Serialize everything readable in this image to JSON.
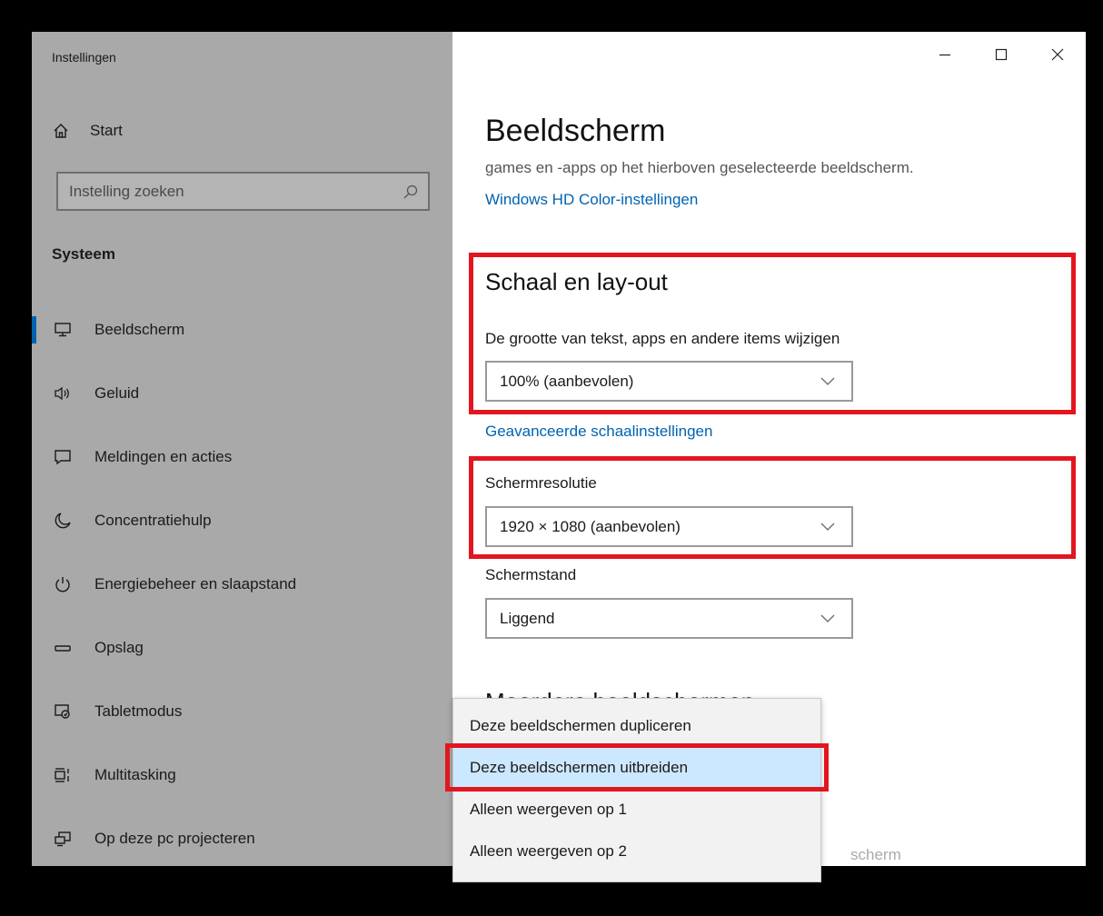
{
  "window": {
    "app_title": "Instellingen"
  },
  "sidebar": {
    "start_label": "Start",
    "search_placeholder": "Instelling zoeken",
    "section_header": "Systeem",
    "items": [
      {
        "label": "Beeldscherm",
        "icon": "monitor-icon",
        "active": true
      },
      {
        "label": "Geluid",
        "icon": "speaker-icon"
      },
      {
        "label": "Meldingen en acties",
        "icon": "notification-icon"
      },
      {
        "label": "Concentratiehulp",
        "icon": "moon-icon"
      },
      {
        "label": "Energiebeheer en slaapstand",
        "icon": "power-icon"
      },
      {
        "label": "Opslag",
        "icon": "storage-icon"
      },
      {
        "label": "Tabletmodus",
        "icon": "tablet-mode-icon"
      },
      {
        "label": "Multitasking",
        "icon": "multitasking-icon"
      },
      {
        "label": "Op deze pc projecteren",
        "icon": "project-icon"
      }
    ]
  },
  "main": {
    "title": "Beeldscherm",
    "description": "games en -apps op het hierboven geselecteerde beeldscherm.",
    "hdr_link": "Windows HD Color-instellingen",
    "scale_section": {
      "heading": "Schaal en lay-out",
      "size_label": "De grootte van tekst, apps en andere items wijzigen",
      "size_value": "100% (aanbevolen)",
      "advanced_link": "Geavanceerde schaalinstellingen"
    },
    "resolution": {
      "label": "Schermresolutie",
      "value": "1920 × 1080 (aanbevolen)"
    },
    "orientation": {
      "label": "Schermstand",
      "value": "Liggend"
    },
    "multi_display": {
      "heading": "Meerdere beeldschermen",
      "options": [
        "Deze beeldschermen dupliceren",
        "Deze beeldschermen uitbreiden",
        "Alleen weergeven op 1",
        "Alleen weergeven op 2"
      ],
      "selected_option": "Deze beeldschermen uitbreiden",
      "obscured_text": "scherm"
    }
  },
  "colors": {
    "accent": "#0063b1",
    "highlight_border": "#e3151f",
    "sidebar_bg": "#a9a9a9",
    "selected_option_bg": "#cce8ff"
  }
}
